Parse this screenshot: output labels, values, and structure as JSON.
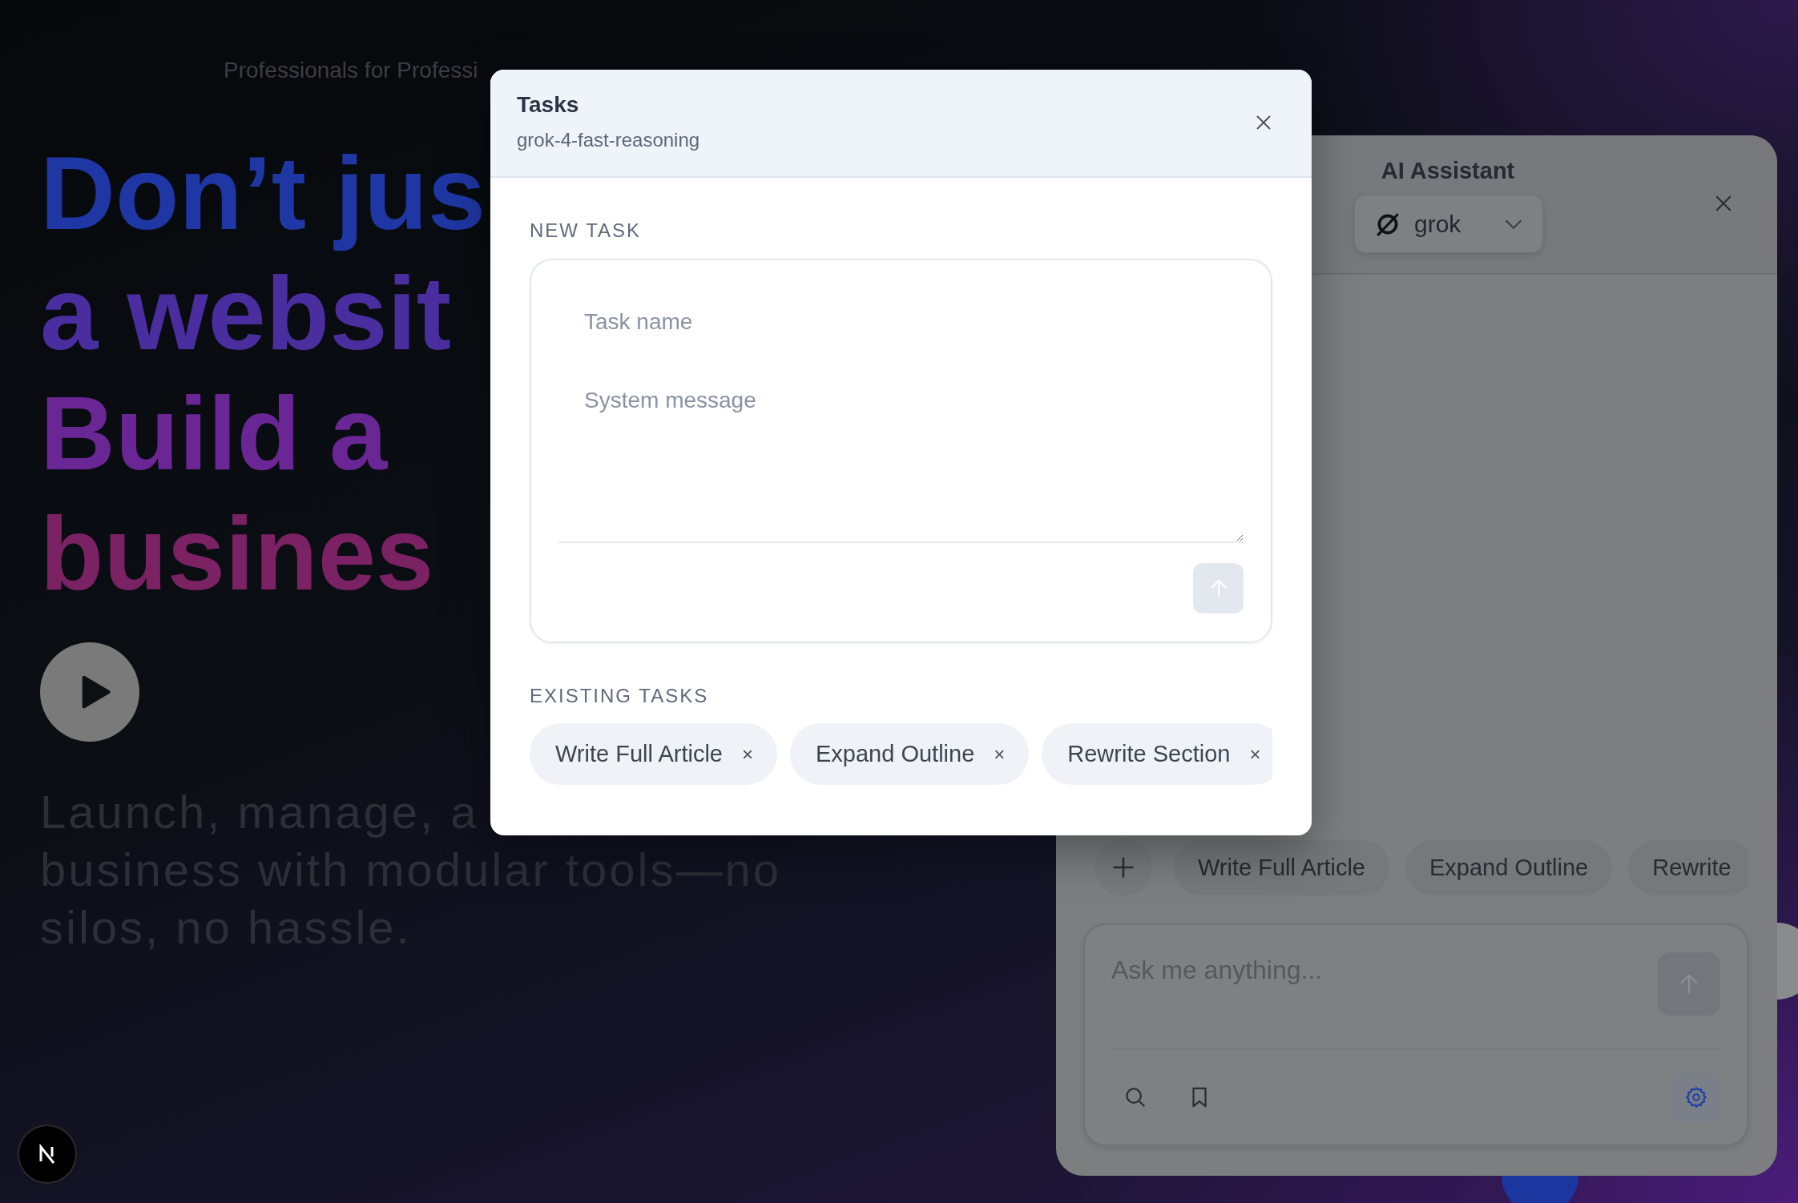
{
  "background": {
    "announcement": "Professionals for Professi",
    "headline": [
      "Don’t jus",
      "a websit",
      "Build a",
      "busines"
    ],
    "subtitle": [
      "Launch, manage, a",
      "business with modular tools—no",
      "silos, no hassle."
    ]
  },
  "assistant_panel": {
    "title": "AI Assistant",
    "model": "grok",
    "quick_tasks": [
      "Write Full Article",
      "Expand Outline",
      "Rewrite"
    ],
    "input": {
      "placeholder": "Ask me anything..."
    }
  },
  "modal": {
    "title": "Tasks",
    "subtitle": "grok-4-fast-reasoning",
    "new_task": {
      "heading": "NEW TASK",
      "name": {
        "placeholder": "Task name"
      },
      "system_message": {
        "placeholder": "System message"
      }
    },
    "existing": {
      "heading": "EXISTING TASKS",
      "tasks": [
        {
          "label": "Write Full Article",
          "remove": "×"
        },
        {
          "label": "Expand Outline",
          "remove": "×"
        },
        {
          "label": "Rewrite Section",
          "remove": "×"
        }
      ]
    }
  }
}
